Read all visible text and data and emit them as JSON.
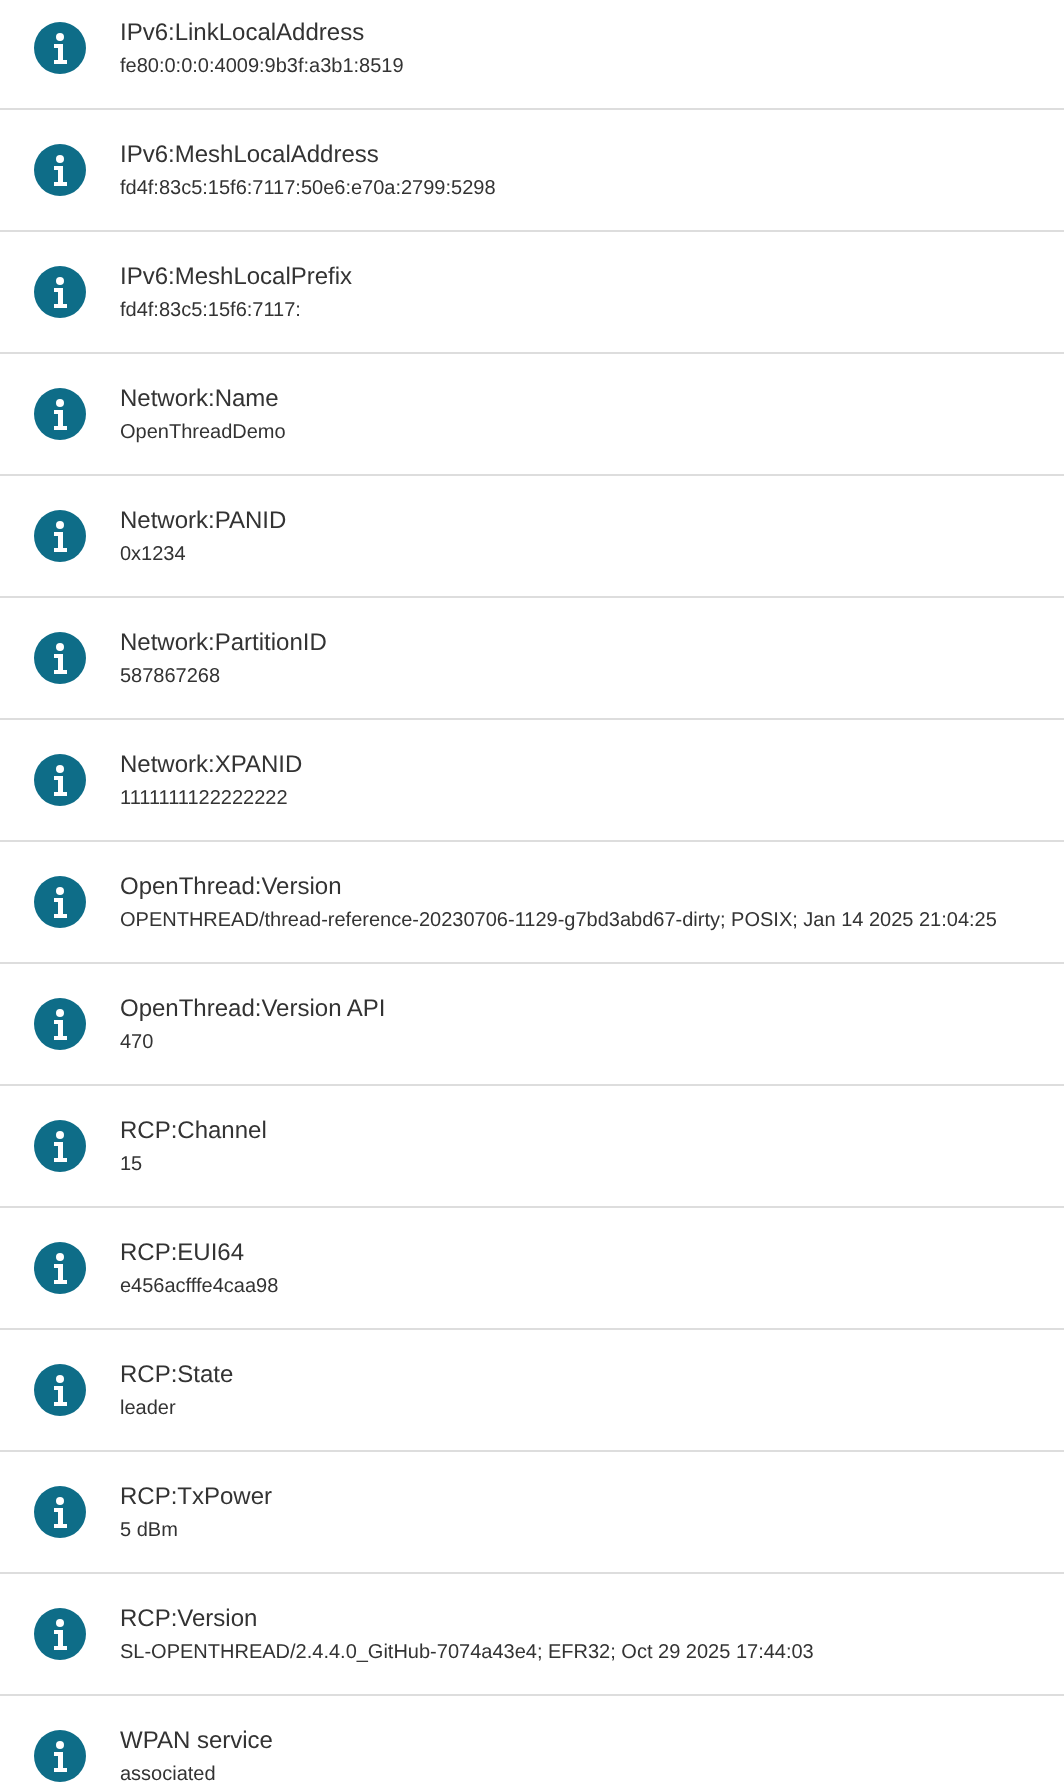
{
  "items": [
    {
      "title": "IPv6:LinkLocalAddress",
      "value": "fe80:0:0:0:4009:9b3f:a3b1:8519"
    },
    {
      "title": "IPv6:MeshLocalAddress",
      "value": "fd4f:83c5:15f6:7117:50e6:e70a:2799:5298"
    },
    {
      "title": "IPv6:MeshLocalPrefix",
      "value": "fd4f:83c5:15f6:7117:"
    },
    {
      "title": "Network:Name",
      "value": "OpenThreadDemo"
    },
    {
      "title": "Network:PANID",
      "value": "0x1234"
    },
    {
      "title": "Network:PartitionID",
      "value": "587867268"
    },
    {
      "title": "Network:XPANID",
      "value": "1111111122222222"
    },
    {
      "title": "OpenThread:Version",
      "value": "OPENTHREAD/thread-reference-20230706-1129-g7bd3abd67-dirty; POSIX; Jan 14 2025 21:04:25"
    },
    {
      "title": "OpenThread:Version API",
      "value": "470"
    },
    {
      "title": "RCP:Channel",
      "value": "15"
    },
    {
      "title": "RCP:EUI64",
      "value": "e456acfffe4caa98"
    },
    {
      "title": "RCP:State",
      "value": "leader"
    },
    {
      "title": "RCP:TxPower",
      "value": "5 dBm"
    },
    {
      "title": "RCP:Version",
      "value": "SL-OPENTHREAD/2.4.4.0_GitHub-7074a43e4; EFR32; Oct 29 2025 17:44:03"
    },
    {
      "title": "WPAN service",
      "value": "associated"
    }
  ]
}
